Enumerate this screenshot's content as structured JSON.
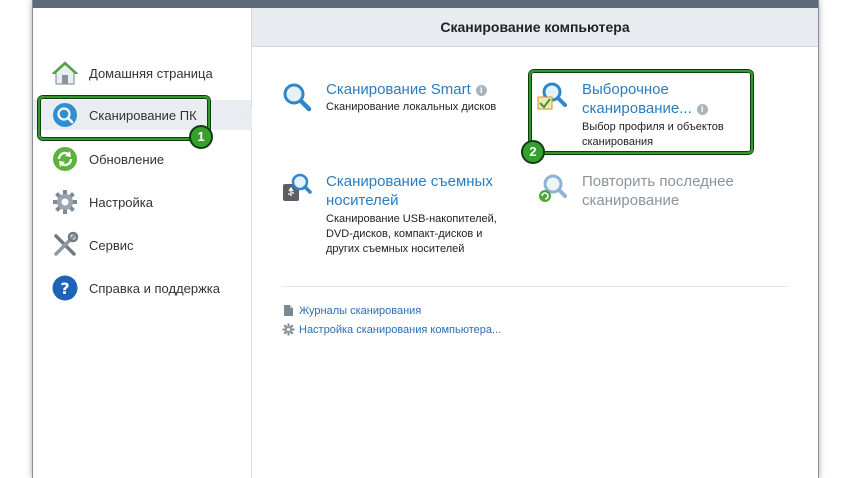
{
  "header": {
    "title": "Сканирование компьютера"
  },
  "sidebar": {
    "items": [
      {
        "label": "Домашняя страница",
        "icon": "home-icon"
      },
      {
        "label": "Сканирование ПК",
        "icon": "scan-icon"
      },
      {
        "label": "Обновление",
        "icon": "update-icon"
      },
      {
        "label": "Настройка",
        "icon": "gear-icon"
      },
      {
        "label": "Сервис",
        "icon": "tools-icon"
      },
      {
        "label": "Справка и поддержка",
        "icon": "help-icon"
      }
    ]
  },
  "tasks": {
    "smart": {
      "title": "Сканирование Smart",
      "desc": "Сканирование локальных дисков"
    },
    "custom": {
      "title_line1": "Выборочное",
      "title_line2": "сканирование...",
      "desc_line1": "Выбор профиля и объектов",
      "desc_line2": "сканирования"
    },
    "removable": {
      "title_line1": "Сканирование съемных",
      "title_line2": "носителей",
      "desc_line1": "Сканирование USB-накопителей,",
      "desc_line2": "DVD-дисков, компакт-дисков и",
      "desc_line3": "других съемных носителей"
    },
    "repeat": {
      "title_line1": "Повторить последнее",
      "title_line2": "сканирование"
    }
  },
  "links": {
    "logs": "Журналы сканирования",
    "settings": "Настройка сканирования компьютера..."
  },
  "annotations": {
    "badge1": "1",
    "badge2": "2"
  },
  "colors": {
    "accent": "#2a7dc0",
    "highlight": "#2f9a2b",
    "header_bg": "#e8ecf0"
  }
}
